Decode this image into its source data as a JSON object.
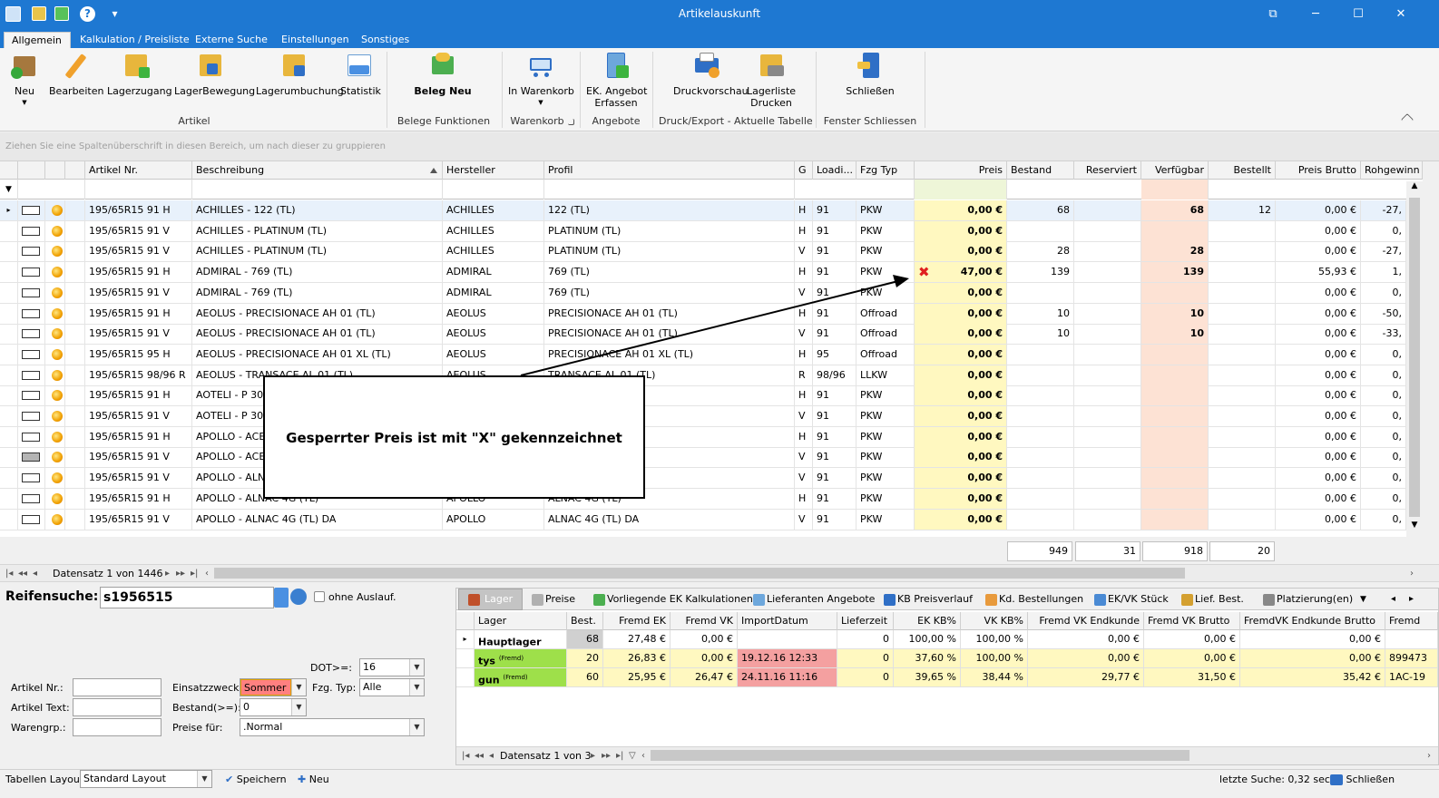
{
  "window": {
    "title": "Artikelauskunft",
    "qat_more": "▾",
    "help": "?",
    "restore": "⧉",
    "minimize": "─",
    "maximize": "☐",
    "close": "✕"
  },
  "tabs": [
    "Allgemein",
    "Kalkulation / Preisliste",
    "Externe Suche",
    "Einstellungen",
    "Sonstiges"
  ],
  "ribbon": {
    "buttons": {
      "neu": "Neu",
      "bearbeiten": "Bearbeiten",
      "lagerzugang": "Lagerzugang",
      "lagerbewegung": "LagerBewegung",
      "lagerumbuchung": "Lagerumbuchung",
      "statistik": "Statistik",
      "beleg_neu": "Beleg Neu",
      "in_warenkorb": "In Warenkorb",
      "ek_angebot_1": "EK. Angebot",
      "ek_angebot_2": "Erfassen",
      "druckvorschau": "Druckvorschau",
      "lagerliste_1": "Lagerliste",
      "lagerliste_2": "Drucken",
      "schliessen": "Schließen"
    },
    "groups": {
      "artikel": "Artikel",
      "belege": "Belege Funktionen",
      "warenkorb": "Warenkorb",
      "angebote": "Angebote",
      "druck": "Druck/Export - Aktuelle Tabelle",
      "fenster": "Fenster Schliessen"
    }
  },
  "group_panel": "Ziehen Sie eine Spaltenüberschrift in diesen Bereich, um nach dieser zu gruppieren",
  "grid": {
    "headers": {
      "artikel": "Artikel Nr.",
      "beschreibung": "Beschreibung",
      "hersteller": "Hersteller",
      "profil": "Profil",
      "g": "G",
      "load": "Loadi...",
      "fzg": "Fzg Typ",
      "preis": "Preis",
      "bestand": "Bestand",
      "reserviert": "Reserviert",
      "verfuegbar": "Verfügbar",
      "bestellt": "Bestellt",
      "brutto": "Preis Brutto",
      "rohgewinn": "Rohgewinn"
    },
    "rows": [
      {
        "art": "195/65R15 91 H",
        "besch": "ACHILLES - 122 (TL)",
        "herst": "ACHILLES",
        "profil": "122 (TL)",
        "g": "H",
        "load": "91",
        "fzg": "PKW",
        "preis": "0,00 €",
        "bestand": "68",
        "reserv": "",
        "verf": "68",
        "bestellt": "12",
        "brutto": "0,00 €",
        "roh": "-27,",
        "gray": false,
        "x": false
      },
      {
        "art": "195/65R15 91 V",
        "besch": "ACHILLES - PLATINUM (TL)",
        "herst": "ACHILLES",
        "profil": "PLATINUM (TL)",
        "g": "H",
        "load": "91",
        "fzg": "PKW",
        "preis": "0,00 €",
        "bestand": "",
        "reserv": "",
        "verf": "",
        "bestellt": "",
        "brutto": "0,00 €",
        "roh": "0,",
        "gray": false,
        "x": false
      },
      {
        "art": "195/65R15 91 V",
        "besch": "ACHILLES - PLATINUM (TL)",
        "herst": "ACHILLES",
        "profil": "PLATINUM (TL)",
        "g": "V",
        "load": "91",
        "fzg": "PKW",
        "preis": "0,00 €",
        "bestand": "28",
        "reserv": "",
        "verf": "28",
        "bestellt": "",
        "brutto": "0,00 €",
        "roh": "-27,",
        "gray": false,
        "x": false
      },
      {
        "art": "195/65R15 91 H",
        "besch": "ADMIRAL - 769 (TL)",
        "herst": "ADMIRAL",
        "profil": "769 (TL)",
        "g": "H",
        "load": "91",
        "fzg": "PKW",
        "preis": "47,00 €",
        "bestand": "139",
        "reserv": "",
        "verf": "139",
        "bestellt": "",
        "brutto": "55,93 €",
        "roh": "1,",
        "gray": false,
        "x": true
      },
      {
        "art": "195/65R15 91 V",
        "besch": "ADMIRAL - 769 (TL)",
        "herst": "ADMIRAL",
        "profil": "769 (TL)",
        "g": "V",
        "load": "91",
        "fzg": "PKW",
        "preis": "0,00 €",
        "bestand": "",
        "reserv": "",
        "verf": "",
        "bestellt": "",
        "brutto": "0,00 €",
        "roh": "0,",
        "gray": false,
        "x": false
      },
      {
        "art": "195/65R15 91 H",
        "besch": "AEOLUS - PRECISIONACE AH 01 (TL)",
        "herst": "AEOLUS",
        "profil": "PRECISIONACE AH 01 (TL)",
        "g": "H",
        "load": "91",
        "fzg": "Offroad",
        "preis": "0,00 €",
        "bestand": "10",
        "reserv": "",
        "verf": "10",
        "bestellt": "",
        "brutto": "0,00 €",
        "roh": "-50,",
        "gray": false,
        "x": false
      },
      {
        "art": "195/65R15 91 V",
        "besch": "AEOLUS - PRECISIONACE AH 01 (TL)",
        "herst": "AEOLUS",
        "profil": "PRECISIONACE AH 01 (TL)",
        "g": "V",
        "load": "91",
        "fzg": "Offroad",
        "preis": "0,00 €",
        "bestand": "10",
        "reserv": "",
        "verf": "10",
        "bestellt": "",
        "brutto": "0,00 €",
        "roh": "-33,",
        "gray": false,
        "x": false
      },
      {
        "art": "195/65R15 95 H",
        "besch": "AEOLUS - PRECISIONACE AH 01 XL (TL)",
        "herst": "AEOLUS",
        "profil": "PRECISIONACE AH 01 XL (TL)",
        "g": "H",
        "load": "95",
        "fzg": "Offroad",
        "preis": "0,00 €",
        "bestand": "",
        "reserv": "",
        "verf": "",
        "bestellt": "",
        "brutto": "0,00 €",
        "roh": "0,",
        "gray": false,
        "x": false
      },
      {
        "art": "195/65R15 98/96 R",
        "besch": "AEOLUS - TRANSACE AL 01 (TL)",
        "herst": "AEOLUS",
        "profil": "TRANSACE AL 01 (TL)",
        "g": "R",
        "load": "98/96",
        "fzg": "LLKW",
        "preis": "0,00 €",
        "bestand": "",
        "reserv": "",
        "verf": "",
        "bestellt": "",
        "brutto": "0,00 €",
        "roh": "0,",
        "gray": false,
        "x": false
      },
      {
        "art": "195/65R15 91 H",
        "besch": "AOTELI - P 307",
        "herst": "",
        "profil": "",
        "g": "H",
        "load": "91",
        "fzg": "PKW",
        "preis": "0,00 €",
        "bestand": "",
        "reserv": "",
        "verf": "",
        "bestellt": "",
        "brutto": "0,00 €",
        "roh": "0,",
        "gray": false,
        "x": false
      },
      {
        "art": "195/65R15 91 V",
        "besch": "AOTELI - P 307",
        "herst": "",
        "profil": "",
        "g": "V",
        "load": "91",
        "fzg": "PKW",
        "preis": "0,00 €",
        "bestand": "",
        "reserv": "",
        "verf": "",
        "bestellt": "",
        "brutto": "0,00 €",
        "roh": "0,",
        "gray": false,
        "x": false
      },
      {
        "art": "195/65R15 91 H",
        "besch": "APOLLO - ACEL",
        "herst": "",
        "profil": "",
        "g": "H",
        "load": "91",
        "fzg": "PKW",
        "preis": "0,00 €",
        "bestand": "",
        "reserv": "",
        "verf": "",
        "bestellt": "",
        "brutto": "0,00 €",
        "roh": "0,",
        "gray": false,
        "x": false
      },
      {
        "art": "195/65R15 91 V",
        "besch": "APOLLO - ACEL",
        "herst": "",
        "profil": "",
        "g": "V",
        "load": "91",
        "fzg": "PKW",
        "preis": "0,00 €",
        "bestand": "",
        "reserv": "",
        "verf": "",
        "bestellt": "",
        "brutto": "0,00 €",
        "roh": "0,",
        "gray": true,
        "x": false
      },
      {
        "art": "195/65R15 91 V",
        "besch": "APOLLO - ALNA",
        "herst": "",
        "profil": "",
        "g": "V",
        "load": "91",
        "fzg": "PKW",
        "preis": "0,00 €",
        "bestand": "",
        "reserv": "",
        "verf": "",
        "bestellt": "",
        "brutto": "0,00 €",
        "roh": "0,",
        "gray": false,
        "x": false
      },
      {
        "art": "195/65R15 91 H",
        "besch": "APOLLO - ALNAC 4G (TL)",
        "herst": "APOLLO",
        "profil": "ALNAC 4G (TL)",
        "g": "H",
        "load": "91",
        "fzg": "PKW",
        "preis": "0,00 €",
        "bestand": "",
        "reserv": "",
        "verf": "",
        "bestellt": "",
        "brutto": "0,00 €",
        "roh": "0,",
        "gray": false,
        "x": false
      },
      {
        "art": "195/65R15 91 V",
        "besch": "APOLLO - ALNAC 4G (TL) DA",
        "herst": "APOLLO",
        "profil": "ALNAC 4G (TL) DA",
        "g": "V",
        "load": "91",
        "fzg": "PKW",
        "preis": "0,00 €",
        "bestand": "",
        "reserv": "",
        "verf": "",
        "bestellt": "",
        "brutto": "0,00 €",
        "roh": "0,",
        "gray": false,
        "x": false
      }
    ],
    "totals": {
      "bestand": "949",
      "reserviert": "31",
      "verfuegbar": "918",
      "bestellt": "20"
    },
    "nav": "Datensatz 1 von 1446"
  },
  "callout": "Gesperrter Preis ist mit \"X\" gekennzeichnet",
  "search": {
    "label": "Reifensuche:",
    "value": "s1956515",
    "ohne_auslauf": "ohne Auslauf.",
    "dot_label": "DOT>=:",
    "dot_value": "16",
    "artikel_nr": "Artikel Nr.:",
    "artikel_text": "Artikel Text:",
    "warengrp": "Warengrp.:",
    "einsatz_label": "Einsatzzweck:",
    "einsatz_value": "Sommer",
    "fzg_label": "Fzg. Typ:",
    "fzg_value": "Alle",
    "bestand_label": "Bestand(>=):",
    "bestand_value": "0",
    "preise_label": "Preise für:",
    "preise_value": ".Normal"
  },
  "subtabs": [
    "Lager",
    "Preise",
    "Vorliegende EK Kalkulationen",
    "Lieferanten Angebote",
    "KB Preisverlauf",
    "Kd. Bestellungen",
    "EK/VK Stück",
    "Lief. Best.",
    "Platzierung(en)"
  ],
  "subgrid": {
    "headers": {
      "lager": "Lager",
      "best": "Best.",
      "fremd_ek": "Fremd EK",
      "fremd_vk": "Fremd VK",
      "import": "ImportDatum",
      "lieferzeit": "Lieferzeit",
      "ek_kb": "EK KB%",
      "vk_kb": "VK KB%",
      "fvk_end": "Fremd VK Endkunde",
      "fvk_brutto": "Fremd VK Brutto",
      "fvk_end_brutto": "FremdVK Endkunde Brutto",
      "fremd": "Fremd"
    },
    "rows": [
      {
        "lager": "Hauptlager",
        "tag": "",
        "best": "68",
        "ek": "27,48 €",
        "vk": "0,00 €",
        "imp": "",
        "lz": "0",
        "ekkb": "100,00 %",
        "vkkb": "100,00 %",
        "end": "0,00 €",
        "brutto": "0,00 €",
        "endbr": "0,00 €",
        "fremd": ""
      },
      {
        "lager": "tys",
        "tag": "(Fremd)",
        "best": "20",
        "ek": "26,83 €",
        "vk": "0,00 €",
        "imp": "19.12.16 12:33",
        "lz": "0",
        "ekkb": "37,60 %",
        "vkkb": "100,00 %",
        "end": "0,00 €",
        "brutto": "0,00 €",
        "endbr": "0,00 €",
        "fremd": "899473"
      },
      {
        "lager": "gun",
        "tag": "(Fremd)",
        "best": "60",
        "ek": "25,95 €",
        "vk": "26,47 €",
        "imp": "24.11.16 11:16",
        "lz": "0",
        "ekkb": "39,65 %",
        "vkkb": "38,44 %",
        "end": "29,77 €",
        "brutto": "31,50 €",
        "endbr": "35,42 €",
        "fremd": "1AC-19"
      }
    ],
    "nav": "Datensatz 1 von 3"
  },
  "statusbar": {
    "layout_label": "Tabellen Layout:",
    "layout_value": "Standard Layout",
    "speichern": "Speichern",
    "neu": "Neu",
    "letzte_suche": "letzte Suche: 0,32 sec",
    "schliessen": "Schließen"
  }
}
